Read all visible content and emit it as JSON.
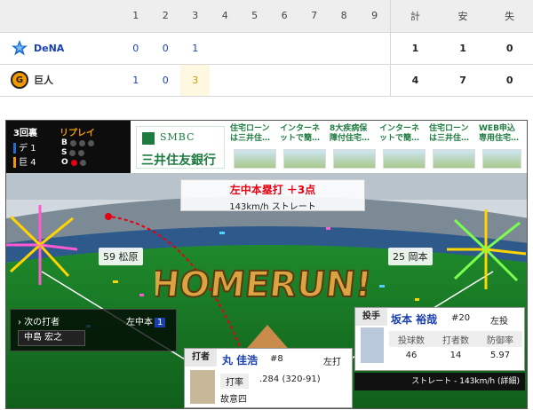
{
  "scoreboard": {
    "innings": [
      "1",
      "2",
      "3",
      "4",
      "5",
      "6",
      "7",
      "8",
      "9"
    ],
    "totals_headers": [
      "計",
      "安",
      "失"
    ],
    "teams": [
      {
        "name": "DeNA",
        "innings": [
          "0",
          "0",
          "1",
          "",
          "",
          "",
          "",
          "",
          ""
        ],
        "r": "1",
        "h": "1",
        "e": "0"
      },
      {
        "name": "巨人",
        "innings": [
          "1",
          "0",
          "3",
          "",
          "",
          "",
          "",
          "",
          ""
        ],
        "r": "4",
        "h": "7",
        "e": "0"
      }
    ]
  },
  "game_state": {
    "inning": "3回裏",
    "replay": "リプレイ",
    "team1_abbr": "デ",
    "team1_score": "1",
    "team2_abbr": "巨",
    "team2_score": "4",
    "b": "B",
    "s": "S",
    "o": "O"
  },
  "ad": {
    "logo_en": "SMBC",
    "logo_ja": "三井住友銀行",
    "cells": [
      {
        "line1": "住宅ローン",
        "line2": "は三井住…"
      },
      {
        "line1": "インターネ",
        "line2": "ットで簡…"
      },
      {
        "line1": "8大疾病保",
        "line2": "障付住宅…"
      },
      {
        "line1": "インターネ",
        "line2": "ットで簡…"
      },
      {
        "line1": "住宅ローン",
        "line2": "は三井住…"
      },
      {
        "line1": "WEB申込",
        "line2": "専用住宅…"
      }
    ]
  },
  "play": {
    "result": "左中本塁打 ＋3点",
    "speed_pitch": "143km/h ストレート",
    "runner_left": "59 松原",
    "runner_right": "25 岡本",
    "homerun_text": "HOMERUN!"
  },
  "next_batter": {
    "label": "次の打者",
    "result_label": "左中本",
    "result_count": "1",
    "name": "中島 宏之"
  },
  "pitcher": {
    "role": "投手",
    "name": "坂本 裕哉",
    "number": "#20",
    "hand": "左投",
    "stat_headers": [
      "投球数",
      "打者数",
      "防御率"
    ],
    "stat_values": [
      "46",
      "14",
      "5.97"
    ],
    "last_pitch": "ストレート - 143km/h (詳細)"
  },
  "batter": {
    "role": "打者",
    "name": "丸 佳浩",
    "number": "#8",
    "hand": "左打",
    "avg_label": "打率",
    "avg": ".284 (320-91)",
    "prev": "故意四"
  }
}
